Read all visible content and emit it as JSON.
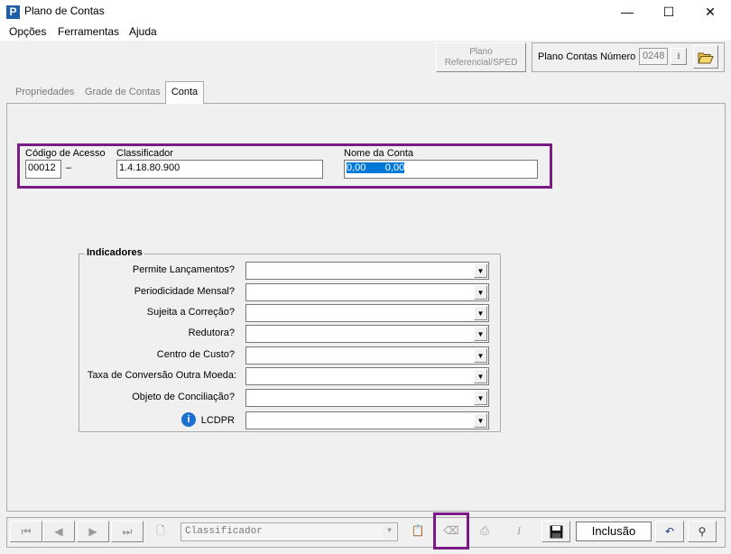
{
  "window": {
    "title": "Plano de Contas",
    "app_icon": "P",
    "controls": [
      "—",
      "☐",
      "✕"
    ]
  },
  "menu": [
    "Opções",
    "Ferramentas",
    "Ajuda"
  ],
  "toolbar": {
    "plano_referencial_label": "Plano Referencial/SPED",
    "plano_contas_numero_label": "Plano Contas Número",
    "plano_contas_numero_value": "0248",
    "open_icon": "folder-open-icon"
  },
  "tabs": [
    {
      "label": "Propriedades",
      "active": false
    },
    {
      "label": "Grade de Contas",
      "active": false
    },
    {
      "label": "Conta",
      "active": true
    }
  ],
  "conta": {
    "codigo_label": "Código de Acesso",
    "codigo_value": "00012",
    "codigo_suffix": "–",
    "classificador_label": "Classificador",
    "classificador_value": "1.4.18.80.900",
    "nome_label": "Nome da Conta",
    "nome_value": "0,00       0,00"
  },
  "indicadores": {
    "title": "Indicadores",
    "items": [
      {
        "label": "Permite Lançamentos?",
        "value": ""
      },
      {
        "label": "Periodicidade Mensal?",
        "value": ""
      },
      {
        "label": "Sujeita a Correção?",
        "value": ""
      },
      {
        "label": "Redutora?",
        "value": ""
      },
      {
        "label": "Centro de Custo?",
        "value": ""
      },
      {
        "label": "Taxa de Conversão Outra Moeda:",
        "value": ""
      },
      {
        "label": "Objeto de Conciliação?",
        "value": ""
      },
      {
        "label": "LCDPR",
        "value": ""
      }
    ]
  },
  "bottom": {
    "search_combo_value": "Classificador",
    "mode_label": "Inclusão"
  },
  "colors": {
    "highlight": "#7a1a84",
    "selection": "#0078d7"
  }
}
